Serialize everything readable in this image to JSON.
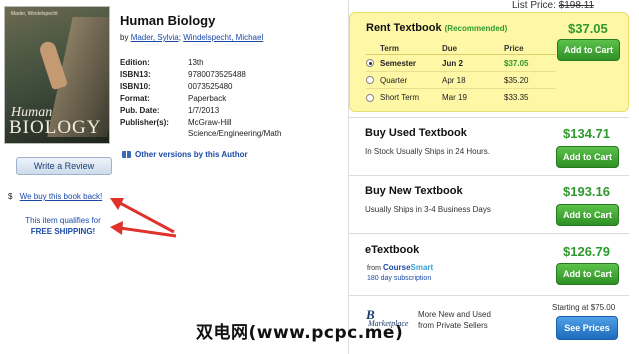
{
  "book": {
    "cover": {
      "authors_text": "Mader, Windelspecht",
      "title_line1": "Human",
      "title_line2": "BIOLOGY"
    },
    "title": "Human Biology",
    "by_prefix": "by",
    "author1": "Mader, Sylvia",
    "separator": ";",
    "author2": "Windelspecht, Michael",
    "details": [
      {
        "label": "Edition:",
        "value": "13th"
      },
      {
        "label": "ISBN13:",
        "value": "9780073525488"
      },
      {
        "label": "ISBN10:",
        "value": "0073525480"
      },
      {
        "label": "Format:",
        "value": "Paperback"
      },
      {
        "label": "Pub. Date:",
        "value": "1/7/2013"
      },
      {
        "label": "Publisher(s):",
        "value": "McGraw-Hill",
        "value2": "Science/Engineering/Math"
      }
    ],
    "other_versions": "Other versions by this Author"
  },
  "left": {
    "write_review": "Write a Review",
    "buyback_symbol": "$",
    "buyback_link": "We buy this book back!",
    "qualifies_line1": "This item qualifies for",
    "qualifies_line2": "FREE SHIPPING!"
  },
  "pricing": {
    "list_price_label": "List Price:",
    "list_price_value": "$198.11",
    "rent": {
      "title": "Rent Textbook",
      "recommended": "(Recommended)",
      "price": "$37.05",
      "button": "Add to Cart",
      "headers": {
        "term": "Term",
        "due": "Due",
        "price": "Price"
      },
      "rows": [
        {
          "term": "Semester",
          "due": "Jun 2",
          "price": "$37.05",
          "selected": true
        },
        {
          "term": "Quarter",
          "due": "Apr 18",
          "price": "$35.20",
          "selected": false
        },
        {
          "term": "Short Term",
          "due": "Mar 19",
          "price": "$33.35",
          "selected": false
        }
      ]
    },
    "used": {
      "title": "Buy Used Textbook",
      "subtitle": "In Stock Usually Ships in 24 Hours.",
      "price": "$134.71",
      "button": "Add to Cart"
    },
    "new": {
      "title": "Buy New Textbook",
      "subtitle": "Usually Ships in 3-4 Business Days",
      "price": "$193.16",
      "button": "Add to Cart"
    },
    "etextbook": {
      "title": "eTextbook",
      "from": "from",
      "brand_a": "Course",
      "brand_b": "Smart",
      "days": "180 day subscription",
      "price": "$126.79",
      "button": "Add to Cart"
    },
    "marketplace": {
      "logo_b": "B",
      "logo_m": "Marketplace",
      "line1": "More New and Used",
      "line2": "from Private Sellers",
      "starting": "Starting at $75.00",
      "button": "See Prices"
    }
  },
  "watermark": "双电网(www.pcpc.me)",
  "colors": {
    "accent_green": "#2e9a2e",
    "link_blue": "#1a4aa8",
    "rent_bg": "#fdf7a6",
    "arrow_red": "#e0312a"
  }
}
